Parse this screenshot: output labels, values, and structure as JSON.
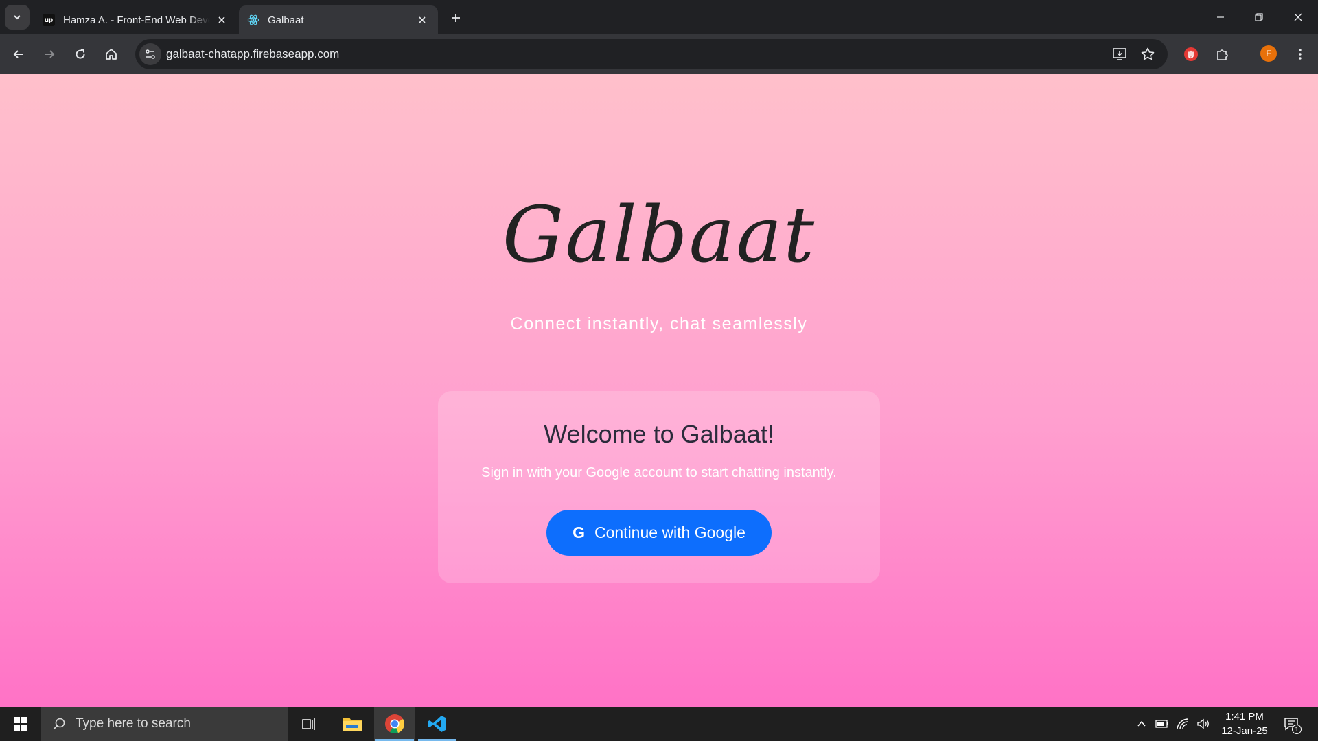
{
  "browser": {
    "tabs": [
      {
        "title": "Hamza A. - Front-End Web Developer",
        "favicon": "upwork-icon",
        "active": false
      },
      {
        "title": "Galbaat",
        "favicon": "react-icon",
        "active": true
      }
    ],
    "address": "galbaat-chatapp.firebaseapp.com",
    "profile_initial": "F",
    "colors": {
      "frame": "#202124",
      "toolbar": "#35363a",
      "profile": "#e8710a"
    }
  },
  "page": {
    "logo": "Galbaat",
    "tagline": "Connect instantly, chat seamlessly",
    "card": {
      "title": "Welcome to Galbaat!",
      "subtitle": "Sign in with your Google account to start chatting instantly.",
      "button_icon": "G",
      "button_label": "Continue with Google"
    },
    "colors": {
      "gradient_top": "#ffc0cb",
      "gradient_bottom": "#ff72c6",
      "button": "#0d6efd"
    }
  },
  "taskbar": {
    "search_placeholder": "Type here to search",
    "apps": [
      "task-view-icon",
      "file-explorer-icon",
      "chrome-icon",
      "vscode-icon"
    ],
    "time": "1:41 PM",
    "date": "12-Jan-25",
    "notification_count": "1"
  }
}
